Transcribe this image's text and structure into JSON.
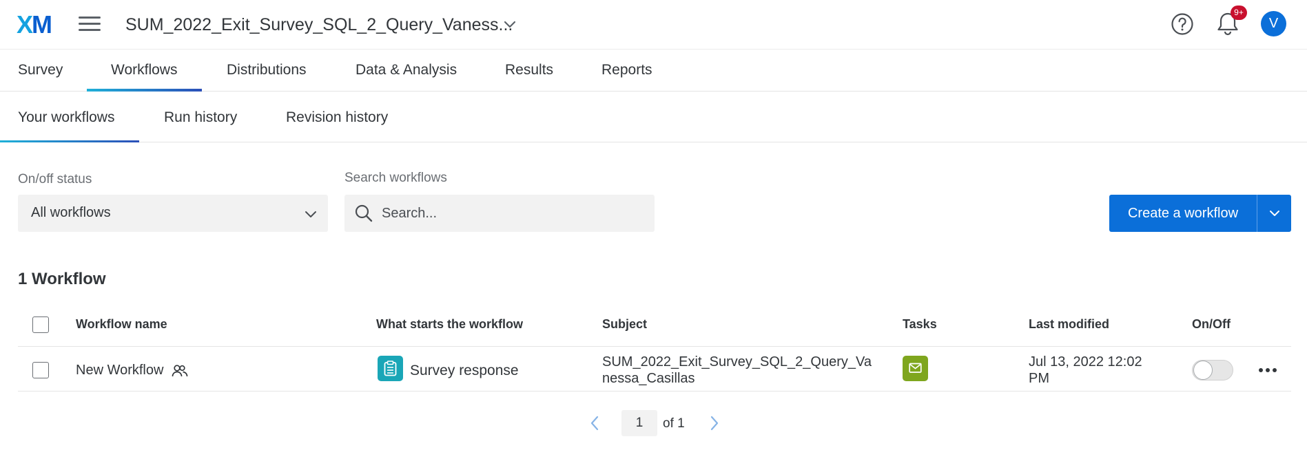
{
  "header": {
    "logo": {
      "x": "X",
      "m": "M"
    },
    "survey_title": "SUM_2022_Exit_Survey_SQL_2_Query_Vaness...",
    "notification_badge": "9+",
    "avatar_initial": "V",
    "icons": [
      "menu-icon",
      "chevron-down-icon",
      "help-icon",
      "bell-icon"
    ]
  },
  "main_tabs": [
    {
      "label": "Survey",
      "active": false
    },
    {
      "label": "Workflows",
      "active": true
    },
    {
      "label": "Distributions",
      "active": false
    },
    {
      "label": "Data & Analysis",
      "active": false
    },
    {
      "label": "Results",
      "active": false
    },
    {
      "label": "Reports",
      "active": false
    }
  ],
  "sub_tabs": [
    {
      "label": "Your workflows",
      "active": true
    },
    {
      "label": "Run history",
      "active": false
    },
    {
      "label": "Revision history",
      "active": false
    }
  ],
  "filters": {
    "status_label": "On/off status",
    "status_value": "All workflows",
    "search_label": "Search workflows",
    "search_placeholder": "Search...",
    "search_value": ""
  },
  "actions": {
    "create_label": "Create a workflow"
  },
  "workflow_count_label": "1 Workflow",
  "table": {
    "columns": [
      "Workflow name",
      "What starts the workflow",
      "Subject",
      "Tasks",
      "Last modified",
      "On/Off"
    ],
    "rows": [
      {
        "name": "New Workflow",
        "shared_icon": "people-icon",
        "trigger": "Survey response",
        "trigger_icon": "clipboard-icon",
        "subject": "SUM_2022_Exit_Survey_SQL_2_Query_Vanessa_Casillas",
        "task_icon": "email-icon",
        "last_modified": "Jul 13, 2022 12:02 PM",
        "enabled": false
      }
    ]
  },
  "pagination": {
    "current_page": "1",
    "of_label": "of 1"
  },
  "colors": {
    "brand_blue": "#0b6fd9",
    "trigger_teal": "#1aa6b7",
    "task_green": "#7fa61e",
    "badge_red": "#c8102e"
  }
}
